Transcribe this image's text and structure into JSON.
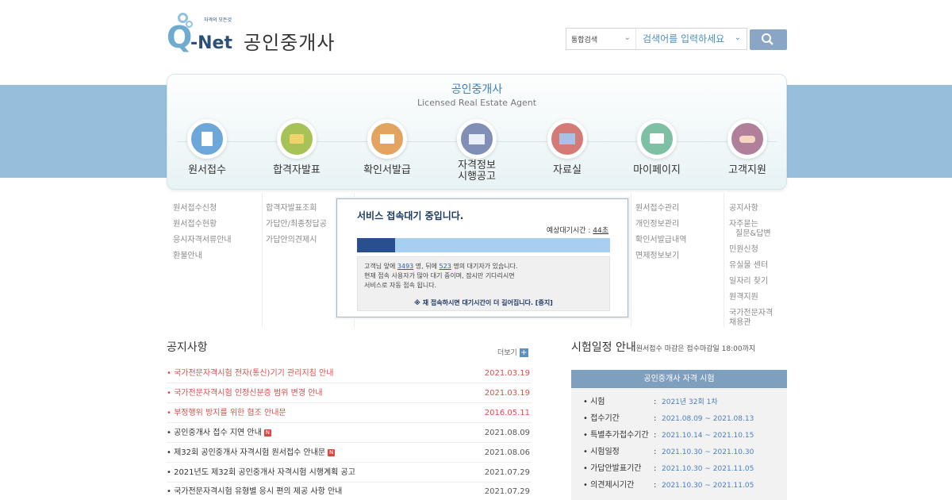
{
  "header": {
    "logo_text": "Q-Net",
    "logo_slogan": "자격의 모든것",
    "site_title": "공인중개사",
    "search": {
      "scope": "통합검색",
      "placeholder": "검색어를 입력하세요"
    }
  },
  "panel": {
    "title": "공인중개사",
    "subtitle": "Licensed Real Estate Agent"
  },
  "nav": [
    {
      "label": "원서접수",
      "icon": "document-icon",
      "color": "#6ea7d9"
    },
    {
      "label": "합격자발표",
      "icon": "megaphone-icon",
      "color": "#a7c257"
    },
    {
      "label": "확인서발급",
      "icon": "printer-icon",
      "color": "#e3a461"
    },
    {
      "label": "자격정보\n시행공고",
      "icon": "id-card-icon",
      "color": "#7f8fb5"
    },
    {
      "label": "자료실",
      "icon": "folder-icon",
      "color": "#d47b78"
    },
    {
      "label": "마이페이지",
      "icon": "monitor-icon",
      "color": "#7ec0a4"
    },
    {
      "label": "고객지원",
      "icon": "handshake-icon",
      "color": "#b07f9a"
    }
  ],
  "submenu": {
    "col1": [
      "원서접수신청",
      "원서접수현황",
      "응시자격서류안내",
      "환불안내"
    ],
    "col2": [
      "합격자발표조회",
      "가답안/최종정답공",
      "가답안의견제시"
    ],
    "col6": [
      "원서접수관리",
      "개인정보관리",
      "확인서발급내역",
      "면제정보보기"
    ],
    "col7": [
      "공지사항",
      "자주묻는",
      "질문&답변",
      "민원신청",
      "유실물 센터",
      "일자리 찾기",
      "원격지원",
      "국가전문자격",
      "채용관"
    ]
  },
  "modal": {
    "title": "서비스 접속대기 중입니다.",
    "wait_label": "예상대기시간 : ",
    "wait_value": "44초",
    "progress": 0.15,
    "line1_pre": "고객님 앞에 ",
    "ahead": "3493",
    "line1_mid": " 명, 뒤에 ",
    "behind": "523",
    "line1_post": " 명의 대기자가 있습니다.",
    "line2": "현재 접속 사용자가 많아 대기 중이며, 잠시만 기다리시면",
    "line3": "서비스로 자동 접속 됩니다.",
    "notice": "※ 재 접속하시면 대기시간이 더 길어집니다. [중지]"
  },
  "notices": {
    "title": "공지사항",
    "more": "더보기",
    "rows": [
      {
        "title": "국가전문자격시험 전자(통신)기기 관리지침 안내",
        "date": "2021.03.19",
        "red": true,
        "new": false
      },
      {
        "title": "국가전문자격시험 인정신분증 범위 변경 안내",
        "date": "2021.03.19",
        "red": true,
        "new": false
      },
      {
        "title": "부정행위 방지를 위한 협조 안내문",
        "date": "2016.05.11",
        "red": true,
        "new": false
      },
      {
        "title": "공인중개사 접수 지연 안내",
        "date": "2021.08.09",
        "red": false,
        "new": true
      },
      {
        "title": "제32회 공인중개사 자격시험 원서접수 안내문",
        "date": "2021.08.06",
        "red": false,
        "new": true
      },
      {
        "title": "2021년도 제32회 공인중개사 자격시험 시행계획 공고",
        "date": "2021.07.29",
        "red": false,
        "new": false
      },
      {
        "title": "국가전문자격시험 유형별 응시 편의 제공 사항 안내",
        "date": "2021.07.29",
        "red": false,
        "new": false
      }
    ]
  },
  "schedule": {
    "title": "시험일정 안내",
    "note": "원서접수 마감은 접수마감일 18:00까지",
    "header": "공인중개사 자격 시험",
    "rows": [
      {
        "key": "시험",
        "value": "2021년 32회 1차"
      },
      {
        "key": "접수기간",
        "value": "2021.08.09 ~ 2021.08.13"
      },
      {
        "key": "특별추가접수기간",
        "value": "2021.10.14 ~ 2021.10.15"
      },
      {
        "key": "시험일정",
        "value": "2021.10.30 ~ 2021.10.30"
      },
      {
        "key": "가답안발표기간",
        "value": "2021.10.30 ~ 2021.11.05"
      },
      {
        "key": "의견제시기간",
        "value": "2021.10.30 ~ 2021.11.05"
      }
    ]
  }
}
